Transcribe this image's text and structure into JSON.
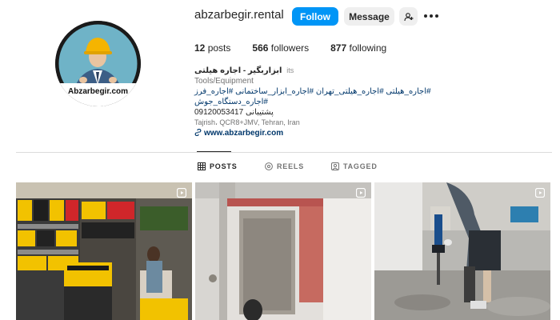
{
  "profile": {
    "avatar_label": "Abzarbegir.com",
    "username": "abzarbegir.rental",
    "follow_label": "Follow",
    "message_label": "Message"
  },
  "stats": {
    "posts_count": "12",
    "posts_label": "posts",
    "followers_count": "566",
    "followers_label": "followers",
    "following_count": "877",
    "following_label": "following"
  },
  "bio": {
    "name": "ابزاربگیر - اجاره هیلتی",
    "handle": "its",
    "category": "Tools/Equipment",
    "tags_line1": "#اجاره_هیلتی #اجاره_هیلتی_تهران #اجاره_ابزار_ساختمانی #اجاره_فرز #اجاره_دستگاه_جوش",
    "support_label": "پشتیبانی",
    "phone": "09120053417",
    "address": "Tajrish، QCR8+JMV, Tehran, Iran",
    "link": "www.abzarbegir.com"
  },
  "tabs": [
    {
      "label": "POSTS",
      "icon": "grid-icon",
      "active": true
    },
    {
      "label": "REELS",
      "icon": "reels-icon",
      "active": false
    },
    {
      "label": "TAGGED",
      "icon": "tagged-icon",
      "active": false
    }
  ],
  "posts": [
    {
      "type": "reel",
      "scene": "hardware store aisle with yellow power tool boxes"
    },
    {
      "type": "reel",
      "scene": "worker drilling a wall opening"
    },
    {
      "type": "reel",
      "scene": "worker using a demolition hammer on concrete"
    }
  ],
  "colors": {
    "accent": "#0095f6",
    "link": "#00376b",
    "muted": "#737373",
    "divider": "#dbdbdb"
  }
}
